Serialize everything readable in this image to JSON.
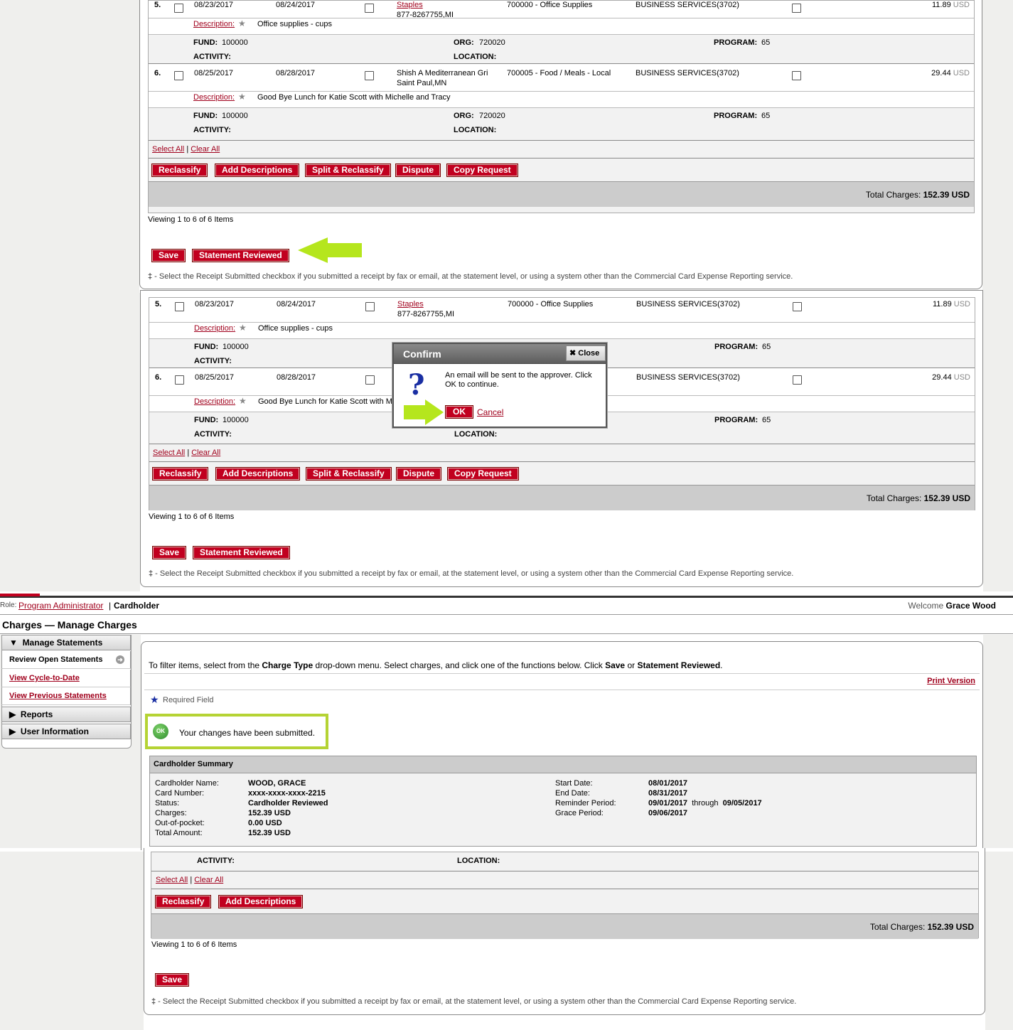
{
  "rows": [
    {
      "num": "5.",
      "post_date": "08/23/2017",
      "trans_date": "08/24/2017",
      "merchant": "Staples",
      "merchant_sub": "877-8267755,MI",
      "gl": "700000 - Office Supplies",
      "business": "BUSINESS SERVICES(3702)",
      "amount": "11.89",
      "currency": "USD",
      "desc_label": "Description",
      "description": "Office supplies - cups",
      "fund_label": "FUND:",
      "fund": "100000",
      "org_label": "ORG:",
      "org": "720020",
      "program_label": "PROGRAM:",
      "program": "65",
      "activity_label": "ACTIVITY:",
      "location_label": "LOCATION:"
    },
    {
      "num": "6.",
      "post_date": "08/25/2017",
      "trans_date": "08/28/2017",
      "merchant": "Shish A Mediterranean Gri",
      "merchant_sub": "Saint Paul,MN",
      "gl": "700005 - Food / Meals - Local",
      "business": "BUSINESS SERVICES(3702)",
      "amount": "29.44",
      "currency": "USD",
      "desc_label": "Description",
      "description": "Good Bye Lunch for Katie Scott with Michelle and Tracy",
      "fund_label": "FUND:",
      "fund": "100000",
      "org_label": "ORG:",
      "org": "720020",
      "program_label": "PROGRAM:",
      "program": "65",
      "activity_label": "ACTIVITY:",
      "location_label": "LOCATION:"
    }
  ],
  "select_all": "Select All",
  "sep": "|",
  "clear_all": "Clear All",
  "buttons": {
    "reclassify": "Reclassify",
    "add_descriptions": "Add Descriptions",
    "split_reclassify": "Split & Reclassify",
    "dispute": "Dispute",
    "copy_request": "Copy Request",
    "save": "Save",
    "statement_reviewed": "Statement Reviewed"
  },
  "total_label": "Total Charges:",
  "total_value": "152.39 USD",
  "viewing": "Viewing 1 to 6 of 6 Items",
  "footnote_mark": "‡",
  "footnote": " - Select the Receipt Submitted checkbox if you submitted a receipt by fax or email, at the statement level, or using a system other than the Commercial Card Expense Reporting service.",
  "confirm": {
    "title": "Confirm",
    "close": "Close",
    "icon": "?",
    "message": "An email will be sent to the approver. Click OK to continue.",
    "ok": "OK",
    "cancel": "Cancel"
  },
  "header": {
    "role_label": "Role:",
    "role_admin": "Program Administrator",
    "role_sep": "|",
    "role_current": "Cardholder",
    "welcome": "Welcome",
    "user": "Grace Wood",
    "page_title": "Charges — Manage Charges"
  },
  "sidebar": {
    "manage": "Manage Statements",
    "review_open": "Review Open Statements",
    "cycle": "View Cycle-to-Date",
    "previous": "View Previous Statements",
    "reports": "Reports",
    "user_info": "User Information"
  },
  "main": {
    "instr_1": "To filter items, select from the ",
    "instr_charge_type": "Charge Type",
    "instr_2": " drop-down menu. Select charges, and click one of the functions below. Click ",
    "instr_save": "Save",
    "instr_or": " or ",
    "instr_reviewed": "Statement Reviewed",
    "instr_end": ".",
    "print": "Print Version",
    "required": "Required Field",
    "ok_badge": "OK",
    "success": "Your changes have been submitted."
  },
  "summary": {
    "title": "Cardholder Summary",
    "left": [
      {
        "label": "Cardholder Name:",
        "value": "WOOD, GRACE"
      },
      {
        "label": "Card Number:",
        "value": "xxxx-xxxx-xxxx-2215"
      },
      {
        "label": "Status:",
        "value": "Cardholder Reviewed"
      },
      {
        "label": "Charges:",
        "value": "152.39 USD"
      },
      {
        "label": "Out-of-pocket:",
        "value": "0.00 USD"
      },
      {
        "label": "Total Amount:",
        "value": "152.39 USD"
      }
    ],
    "right": [
      {
        "label": "Start Date:",
        "value": "08/01/2017"
      },
      {
        "label": "End Date:",
        "value": "08/31/2017"
      },
      {
        "label": "Reminder Period:",
        "value": "09/01/2017"
      },
      {
        "label": "Grace Period:",
        "value": "09/06/2017"
      }
    ],
    "through": "through",
    "reminder_end": "09/05/2017"
  },
  "colors": {
    "button": "#c1001f",
    "link": "#a0001c",
    "arrow": "#b5e61d",
    "highlight": "#b5d334"
  }
}
